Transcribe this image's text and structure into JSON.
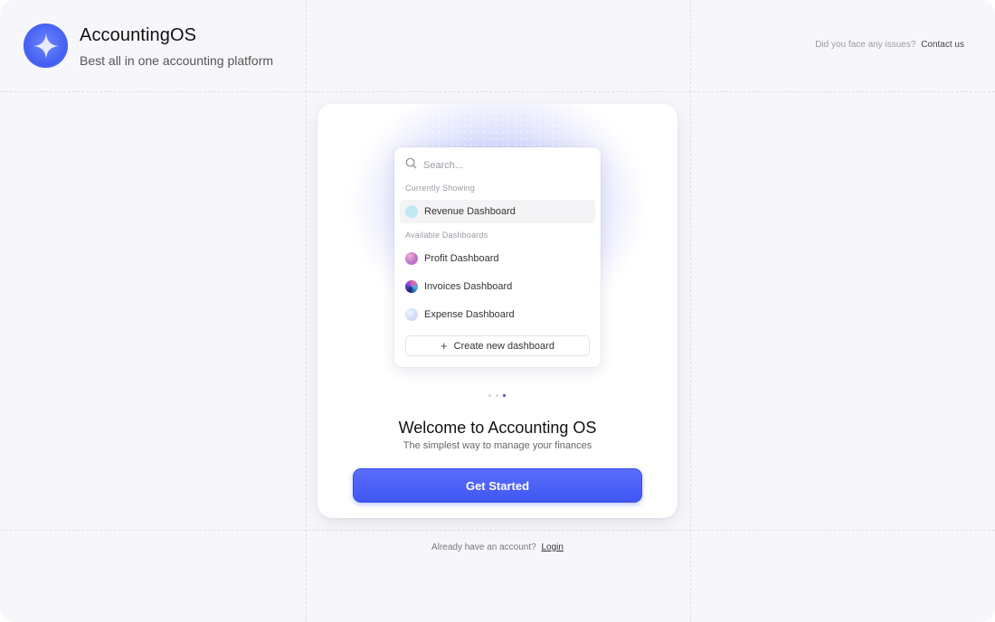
{
  "brand": {
    "title": "AccountingOS",
    "subtitle": "Best all in one accounting platform",
    "logo_icon": "sparkle-icon",
    "accent_color": "#3f57f3"
  },
  "support": {
    "prompt": "Did you face any issues?",
    "link": "Contact us"
  },
  "dropdown": {
    "search_placeholder": "Search...",
    "search_value": "",
    "current_label": "Currently Showing",
    "current_item": {
      "label": "Revenue Dashboard",
      "color": "#bfeaf5"
    },
    "available_label": "Available Dashboards",
    "items": [
      {
        "label": "Profit Dashboard",
        "color": "#e08aa8"
      },
      {
        "label": "Invoices Dashboard",
        "color": "#2c2f8a"
      },
      {
        "label": "Expense Dashboard",
        "color": "#d6d9fb"
      }
    ],
    "create_label": "Create new dashboard"
  },
  "pager": {
    "count": 3,
    "active_index": 2
  },
  "welcome": {
    "title": "Welcome to Accounting OS",
    "subtitle": "The simplest way to manage your finances",
    "cta": "Get Started"
  },
  "footer": {
    "prompt": "Already have an account?",
    "link": "Login"
  }
}
